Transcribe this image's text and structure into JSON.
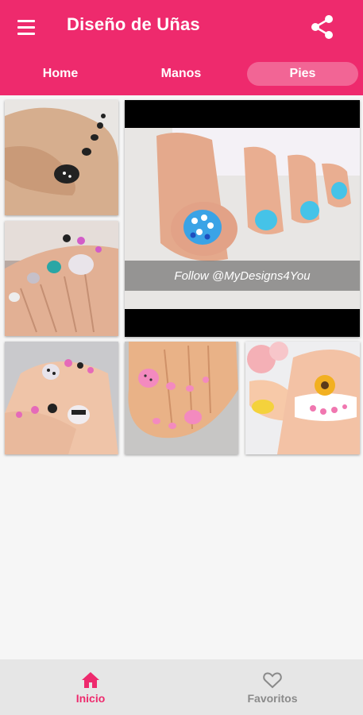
{
  "app": {
    "title": "Diseño de Uñas",
    "accent_color": "#ee2a6d",
    "menu_icon": "hamburger-menu-icon",
    "share_icon": "share-icon"
  },
  "tabs": [
    {
      "label": "Home",
      "selected": false
    },
    {
      "label": "Manos",
      "selected": false
    },
    {
      "label": "Pies",
      "selected": true
    }
  ],
  "gallery": {
    "watermark_text": "Follow @MyDesigns4You",
    "images": [
      {
        "description": "toenails black with dots"
      },
      {
        "description": "large photo blue toenails with white dots"
      },
      {
        "description": "toenails pink teal with lace"
      },
      {
        "description": "toenails pink black white"
      },
      {
        "description": "toenails pink with dots"
      },
      {
        "description": "toenails white with sunflower"
      }
    ]
  },
  "bottom_nav": {
    "items": [
      {
        "label": "Inicio",
        "icon": "home-icon",
        "active": true
      },
      {
        "label": "Favoritos",
        "icon": "heart-outline-icon",
        "active": false
      }
    ]
  }
}
